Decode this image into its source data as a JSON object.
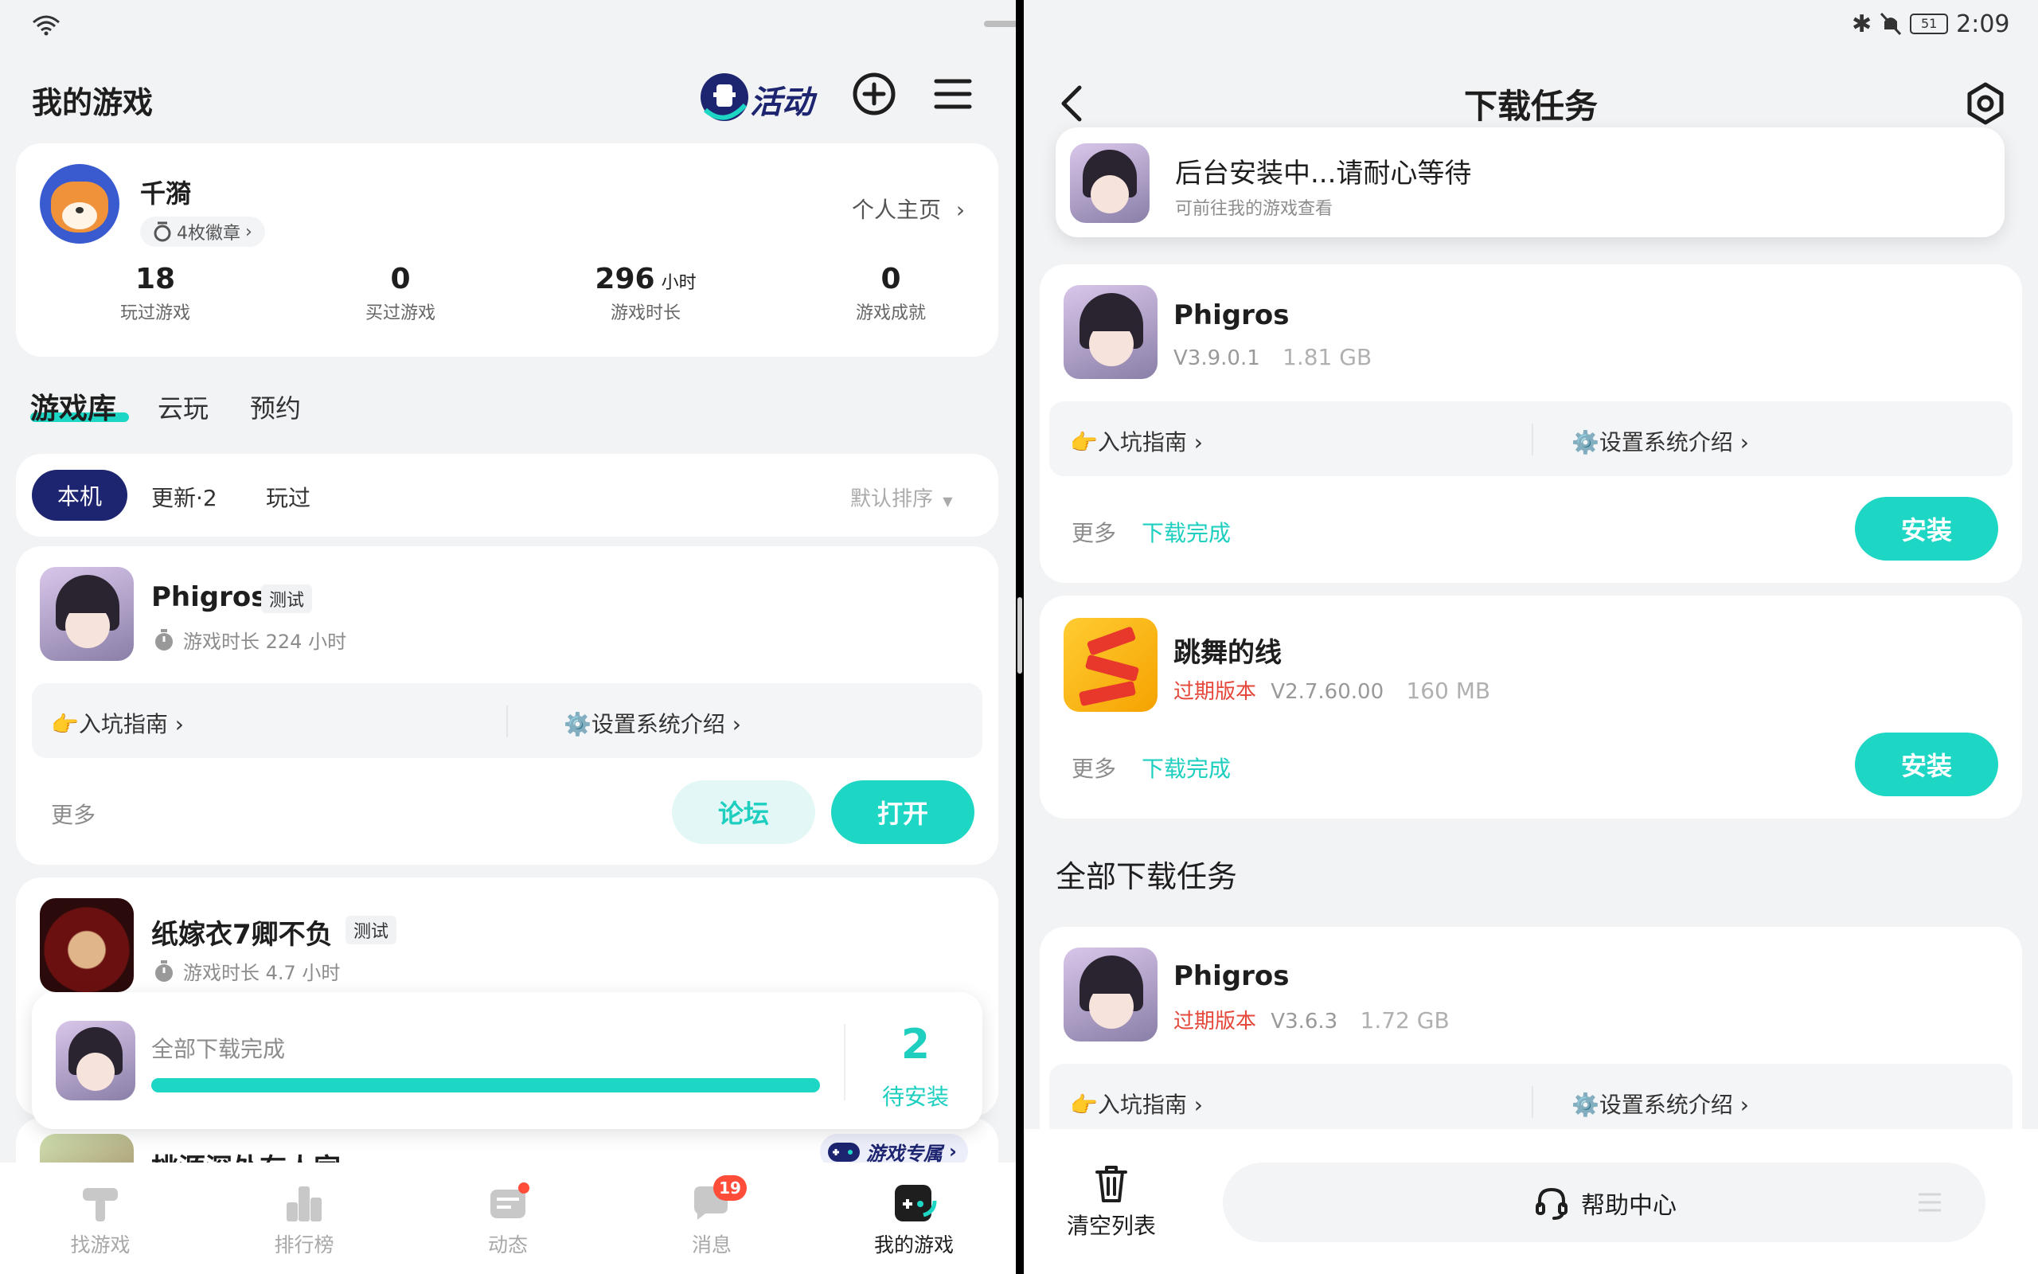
{
  "status_bar": {
    "time": "2:09",
    "battery": "51"
  },
  "left": {
    "title": "我的游戏",
    "activity_badge": "活动",
    "profile": {
      "name": "千漪",
      "badges": "4枚徽章",
      "home_link": "个人主页",
      "stats": [
        {
          "value": "18",
          "unit": "",
          "label": "玩过游戏"
        },
        {
          "value": "0",
          "unit": "",
          "label": "买过游戏"
        },
        {
          "value": "296",
          "unit": "小时",
          "label": "游戏时长"
        },
        {
          "value": "0",
          "unit": "",
          "label": "游戏成就"
        }
      ]
    },
    "tabs": [
      "游戏库",
      "云玩",
      "预约"
    ],
    "filters": {
      "local": "本机",
      "updates": "更新·2",
      "played": "玩过",
      "sort": "默认排序"
    },
    "games": [
      {
        "name": "Phigros",
        "tag": "测试",
        "playtime": "游戏时长 224 小时",
        "guide": "👉入坑指南",
        "system": "⚙️设置系统介绍",
        "more": "更多",
        "forum": "论坛",
        "open": "打开"
      },
      {
        "name": "纸嫁衣7卿不负",
        "tag": "测试",
        "playtime": "游戏时长 4.7 小时"
      },
      {
        "name": "桃源深处有人家",
        "exclusive": "游戏专属"
      }
    ],
    "download_bar": {
      "status": "全部下载完成",
      "count": "2",
      "pending": "待安装",
      "progress": 1.0
    },
    "nav": [
      {
        "label": "找游戏",
        "badge": ""
      },
      {
        "label": "排行榜",
        "badge": ""
      },
      {
        "label": "动态",
        "badge": ""
      },
      {
        "label": "消息",
        "badge": "19"
      },
      {
        "label": "我的游戏",
        "badge": ""
      }
    ]
  },
  "right": {
    "title": "下载任务",
    "toast": {
      "title": "后台安装中...请耐心等待",
      "sub": "可前往我的游戏查看"
    },
    "tasks": [
      {
        "name": "Phigros",
        "expired": "",
        "version": "V3.9.0.1",
        "size": "1.81 GB",
        "guide": "👉入坑指南",
        "system": "⚙️设置系统介绍",
        "more": "更多",
        "status": "下载完成",
        "action": "安装"
      },
      {
        "name": "跳舞的线",
        "expired": "过期版本",
        "version": "V2.7.60.00",
        "size": "160 MB",
        "more": "更多",
        "status": "下载完成",
        "action": "安装"
      }
    ],
    "all_title": "全部下载任务",
    "all_tasks": [
      {
        "name": "Phigros",
        "expired": "过期版本",
        "version": "V3.6.3",
        "size": "1.72 GB",
        "guide": "👉入坑指南",
        "system": "⚙️设置系统介绍"
      }
    ],
    "clear_label": "清空列表",
    "help_label": "帮助中心"
  },
  "colors": {
    "accent": "#1ed6c4",
    "navy": "#1d2470",
    "red": "#e5473a"
  }
}
